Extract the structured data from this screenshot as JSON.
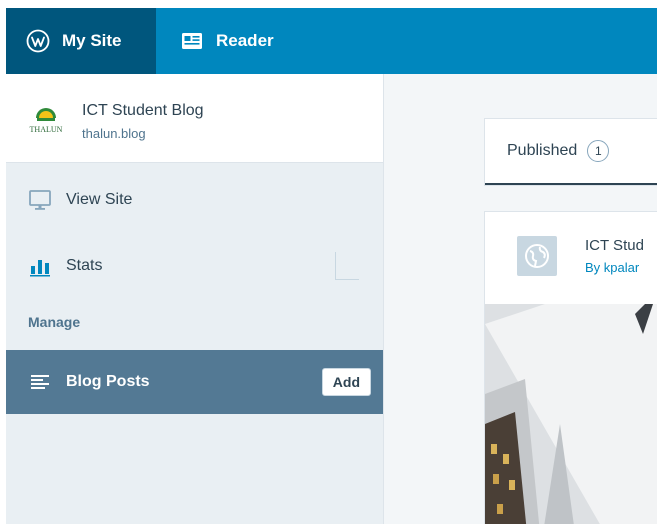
{
  "masterbar": {
    "my_site_label": "My Site",
    "reader_label": "Reader",
    "my_site_icon": "wordpress-logo-icon",
    "reader_icon": "reader-icon",
    "colors": {
      "bar": "#0087be",
      "active": "#00567d"
    }
  },
  "site": {
    "title": "ICT Student Blog",
    "domain": "thalun.blog",
    "logo_text": "THALUN"
  },
  "nav": {
    "view_site": "View Site",
    "stats": "Stats",
    "manage_heading": "Manage",
    "blog_posts": "Blog Posts",
    "add_label": "Add"
  },
  "content": {
    "tab_published": "Published",
    "published_count": "1",
    "post_site": "ICT Stud",
    "post_author": "By kpalar"
  },
  "colors": {
    "selected_row": "#537994",
    "sidebar_bg": "#e9eff3",
    "link": "#0087be"
  }
}
